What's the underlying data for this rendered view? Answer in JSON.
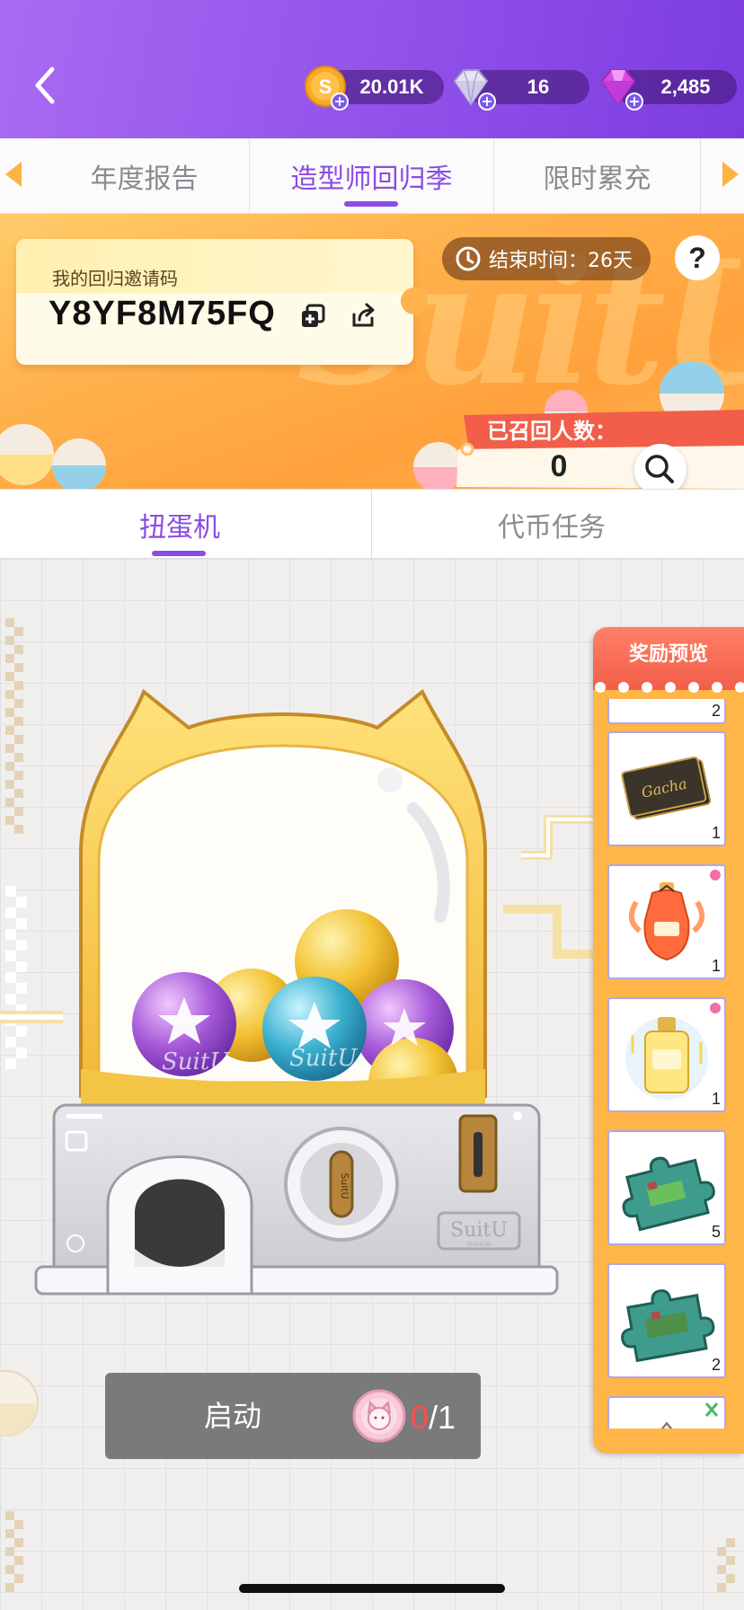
{
  "header": {
    "currencies": [
      {
        "icon": "gold-coin-icon",
        "value": "20.01K"
      },
      {
        "icon": "diamond-icon",
        "value": "16"
      },
      {
        "icon": "purple-gem-icon",
        "value": "2,485"
      }
    ]
  },
  "top_tabs": [
    "年度报告",
    "造型师回归季",
    "限时累充"
  ],
  "top_tab_active": 1,
  "banner": {
    "invite_label": "我的回归邀请码",
    "invite_code": "Y8YF8M75FQ",
    "end_time": "结束时间：26天",
    "help": "?",
    "recall_title": "已召回人数：",
    "recall_count": "0"
  },
  "sub_tabs": [
    "扭蛋机",
    "代币任务"
  ],
  "sub_tab_active": 0,
  "reward_preview": {
    "title": "奖励预览",
    "items": [
      {
        "name": "partial-item",
        "qty": "2"
      },
      {
        "name": "gacha-ticket",
        "qty": "1"
      },
      {
        "name": "orange-perfume",
        "qty": "1"
      },
      {
        "name": "gold-perfume",
        "qty": "1"
      },
      {
        "name": "puzzle-piece",
        "qty": "5"
      },
      {
        "name": "puzzle-piece",
        "qty": "2"
      },
      {
        "name": "partial-item",
        "qty": ""
      }
    ]
  },
  "machine": {
    "brand": "SuitU",
    "brand_sub": "FASHION",
    "ball_text": "SuitU"
  },
  "start_button": {
    "label": "启动",
    "cost_used": "0",
    "cost_sep": "/",
    "cost_total": "1"
  },
  "colors": {
    "accent": "#8b4ce2",
    "header": "#9a58ea",
    "banner": "#ffb24d",
    "reward_head": "#f25e4a"
  }
}
